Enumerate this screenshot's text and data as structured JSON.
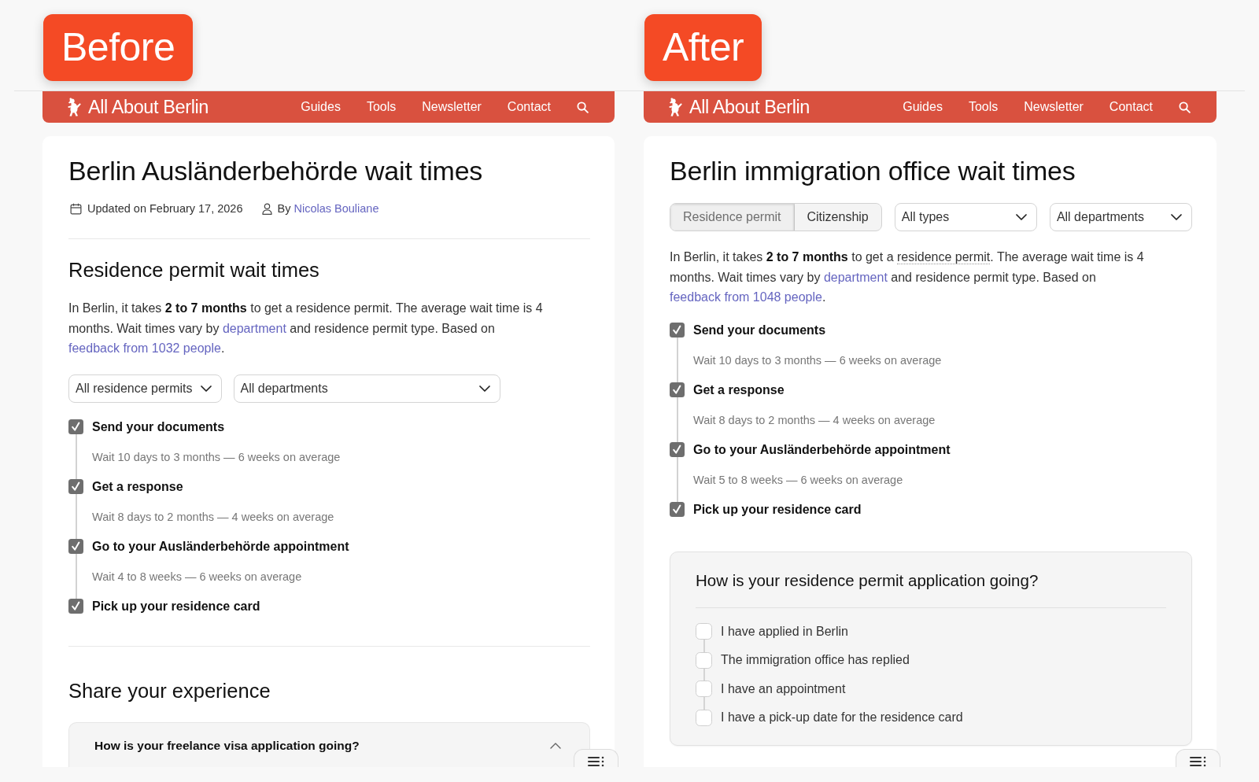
{
  "panels": [
    {
      "badge": "Before",
      "site_header": {
        "logo": "All About Berlin",
        "nav": [
          "Guides",
          "Tools",
          "Newsletter",
          "Contact"
        ]
      },
      "blocks": [
        {
          "kind": "title",
          "text": "Berlin Ausländerbehörde wait times"
        },
        {
          "kind": "meta",
          "updated": "Updated on February 17, 2026",
          "author_prefix": "By",
          "author": "Nicolas Bouliane"
        },
        {
          "kind": "divider"
        },
        {
          "kind": "heading",
          "text": "Residence permit wait times"
        },
        {
          "kind": "paragraph",
          "parts": [
            {
              "kind": "text",
              "text": "In Berlin, it takes **2 to 7 months** to get a residence permit. The average wait time is 4 months. Wait times vary by "
            },
            {
              "kind": "link",
              "text": "department"
            },
            {
              "kind": "text",
              "text": " and residence permit type. Based on "
            },
            {
              "kind": "link",
              "text": "feedback from 1032 people"
            },
            {
              "kind": "text",
              "text": "."
            }
          ]
        },
        {
          "kind": "filters",
          "items": [
            {
              "kind": "select",
              "value": "All residence permits"
            },
            {
              "kind": "select",
              "value": "All departments"
            }
          ]
        },
        {
          "kind": "steps",
          "items": [
            {
              "label": "Send your documents",
              "wait": "Wait 10 days to 3 months — 6 weeks on average",
              "checked": true
            },
            {
              "label": "Get a response",
              "wait": "Wait 8 days to 2 months — 4 weeks on average",
              "checked": true
            },
            {
              "label": "Go to your Ausländerbehörde appointment",
              "wait": "Wait 4 to 8 weeks — 6 weeks on average",
              "checked": true
            },
            {
              "label": "Pick up your residence card",
              "checked": true
            }
          ]
        },
        {
          "kind": "divider"
        },
        {
          "kind": "heading",
          "text": "Share your experience"
        },
        {
          "kind": "accordion",
          "question": "How is your freelance visa application going?",
          "expanded": true
        }
      ]
    },
    {
      "badge": "After",
      "site_header": {
        "logo": "All About Berlin",
        "nav": [
          "Guides",
          "Tools",
          "Newsletter",
          "Contact"
        ]
      },
      "blocks": [
        {
          "kind": "title",
          "text": "Berlin immigration office wait times"
        },
        {
          "kind": "filters",
          "items": [
            {
              "kind": "segmented",
              "options": [
                {
                  "label": "Residence permit",
                  "selected": true
                },
                {
                  "label": "Citizenship",
                  "selected": false
                }
              ]
            },
            {
              "kind": "select",
              "value": "All types"
            },
            {
              "kind": "select",
              "value": "All departments"
            }
          ]
        },
        {
          "kind": "paragraph",
          "parts": [
            {
              "kind": "text",
              "text": "In Berlin, it takes **2 to 7 months** to get a "
            },
            {
              "kind": "term",
              "text": "residence permit"
            },
            {
              "kind": "text",
              "text": ". The average wait time is 4 months. Wait times vary by "
            },
            {
              "kind": "link",
              "text": "department"
            },
            {
              "kind": "text",
              "text": " and residence permit type. Based on "
            },
            {
              "kind": "link",
              "text": "feedback from 1048 people"
            },
            {
              "kind": "text",
              "text": "."
            }
          ]
        },
        {
          "kind": "steps",
          "items": [
            {
              "label": "Send your documents",
              "wait": "Wait 10 days to 3 months — 6 weeks on average",
              "checked": true
            },
            {
              "label": "Get a response",
              "wait": "Wait 8 days to 2 months — 4 weeks on average",
              "checked": true
            },
            {
              "label": "Go to your Ausländerbehörde appointment",
              "wait": "Wait 5 to 8 weeks — 6 weeks on average",
              "checked": true
            },
            {
              "label": "Pick up your residence card",
              "checked": true
            }
          ]
        },
        {
          "kind": "survey",
          "question": "How is your residence permit application going?",
          "options": [
            {
              "label": "I have applied in Berlin",
              "checked": false
            },
            {
              "label": "The immigration office has replied",
              "checked": false
            },
            {
              "label": "I have an appointment",
              "checked": false
            },
            {
              "label": "I have a pick-up date for the residence card",
              "checked": false
            }
          ]
        }
      ]
    }
  ]
}
